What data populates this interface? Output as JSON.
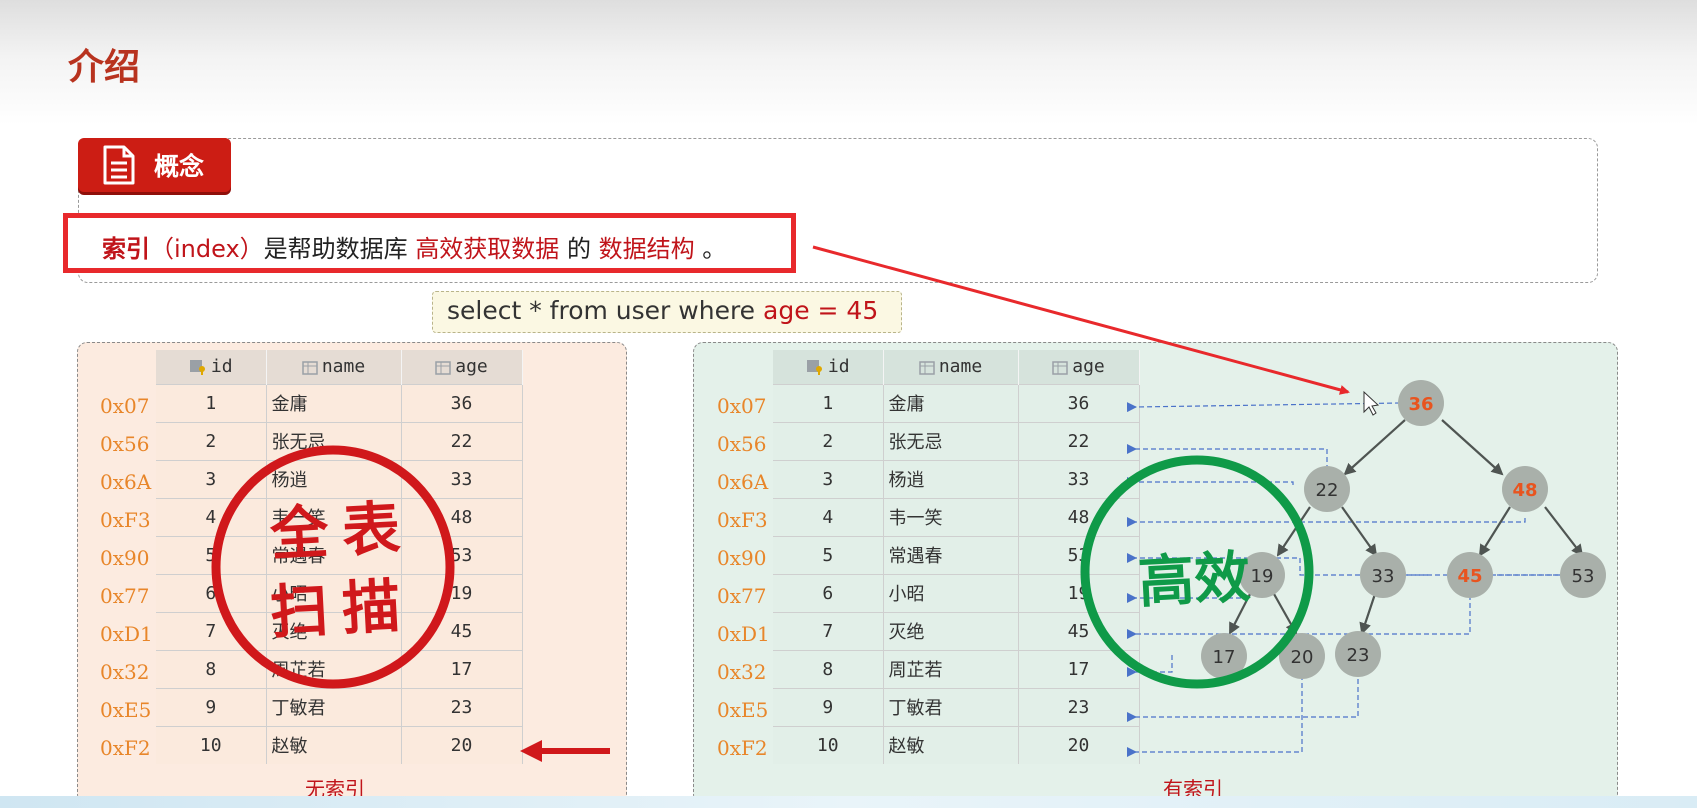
{
  "slide": {
    "title": "介绍",
    "concept_label": "概念",
    "definition": {
      "term": "索引",
      "english": "（index）",
      "middle": "是帮助数据库",
      "highlight1": "高效获取数据",
      "connector": "的",
      "highlight2": "数据结构",
      "end": "。"
    },
    "sql": {
      "prefix": "select * from user where ",
      "condition": "age = 45"
    }
  },
  "table": {
    "columns": [
      "id",
      "name",
      "age"
    ],
    "rows": [
      {
        "addr": "0x07",
        "id": "1",
        "name": "金庸",
        "age": "36"
      },
      {
        "addr": "0x56",
        "id": "2",
        "name": "张无忌",
        "age": "22"
      },
      {
        "addr": "0x6A",
        "id": "3",
        "name": "杨逍",
        "age": "33"
      },
      {
        "addr": "0xF3",
        "id": "4",
        "name": "韦一笑",
        "age": "48"
      },
      {
        "addr": "0x90",
        "id": "5",
        "name": "常遇春",
        "age": "53"
      },
      {
        "addr": "0x77",
        "id": "6",
        "name": "小昭",
        "age": "19"
      },
      {
        "addr": "0xD1",
        "id": "7",
        "name": "灭绝",
        "age": "45"
      },
      {
        "addr": "0x32",
        "id": "8",
        "name": "周芷若",
        "age": "17"
      },
      {
        "addr": "0xE5",
        "id": "9",
        "name": "丁敏君",
        "age": "23"
      },
      {
        "addr": "0xF2",
        "id": "10",
        "name": "赵敏",
        "age": "20"
      }
    ]
  },
  "left_panel": {
    "caption": "无索引",
    "stamp_line1": "全表",
    "stamp_line2": "扫描"
  },
  "right_panel": {
    "caption": "有索引",
    "stamp": "高效",
    "tree_nodes": [
      "36",
      "22",
      "48",
      "19",
      "33",
      "45",
      "53",
      "17",
      "20",
      "23"
    ],
    "highlighted_nodes": [
      "36",
      "48",
      "45"
    ]
  },
  "colors": {
    "title": "#b8331f",
    "accent_red": "#c0141a",
    "stamp_red": "#d0181b",
    "stamp_green": "#0f9a48",
    "address_orange": "#e8862a",
    "node_gray": "#a9b0aa",
    "node_highlight_text": "#e8541f"
  }
}
